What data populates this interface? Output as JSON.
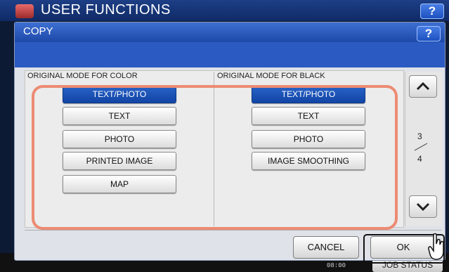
{
  "background": {
    "title": "USER FUNCTIONS",
    "help_label": "?",
    "clock": "08:00",
    "job_status": "JOB STATUS"
  },
  "dialog": {
    "title": "COPY",
    "help_label": "?",
    "color_section": {
      "label": "ORIGINAL MODE FOR COLOR",
      "options": [
        "TEXT/PHOTO",
        "TEXT",
        "PHOTO",
        "PRINTED IMAGE",
        "MAP"
      ],
      "selected": "TEXT/PHOTO"
    },
    "black_section": {
      "label": "ORIGINAL MODE FOR BLACK",
      "options": [
        "TEXT/PHOTO",
        "TEXT",
        "PHOTO",
        "IMAGE SMOOTHING"
      ],
      "selected": "TEXT/PHOTO"
    },
    "pager": {
      "current": "3",
      "total": "4"
    },
    "cancel_label": "CANCEL",
    "ok_label": "OK"
  },
  "colors": {
    "selected_button": "#1f56b8",
    "highlight": "#ec8b73",
    "title_bar": "#2b5bc2"
  }
}
